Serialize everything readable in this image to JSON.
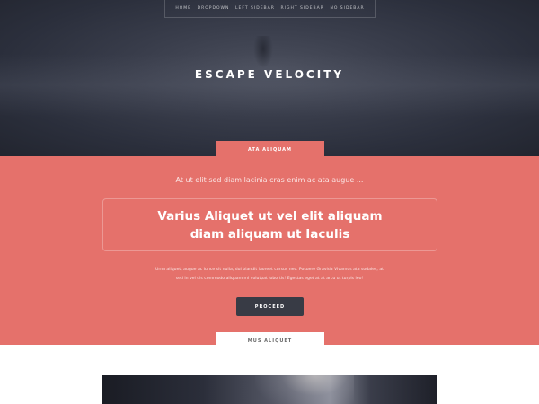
{
  "nav": {
    "items": [
      "HOME",
      "DROPDOWN",
      "LEFT SIDEBAR",
      "RIGHT SIDEBAR",
      "NO SIDEBAR"
    ]
  },
  "hero": {
    "title": "ESCAPE VELOCITY"
  },
  "banner": {
    "tab_label": "ATA ALIQUAM",
    "intro": "At ut elit sed diam lacinia cras enim ac ata augue ...",
    "headline_line1": "Varius Aliquet ut vel elit aliquam",
    "headline_line2": "diam aliquam ut Iaculis",
    "body_line1": "Urna aliquet, augue ac lunce sit nulla, dui blandit laoreet cursus nec. Posuere Gravida Vivamus ata sodales, at",
    "body_line2": "sed in vel dis commodo aliquam mi volutpat lobortis! Egestas eget at at arcu ut turpis leo!",
    "button_label": "PROCEED"
  },
  "section": {
    "tab_label": "MUS ALIQUET"
  },
  "colors": {
    "accent": "#e5716b",
    "header_dark": "#2b2f3c",
    "button_dark": "#383b45"
  }
}
